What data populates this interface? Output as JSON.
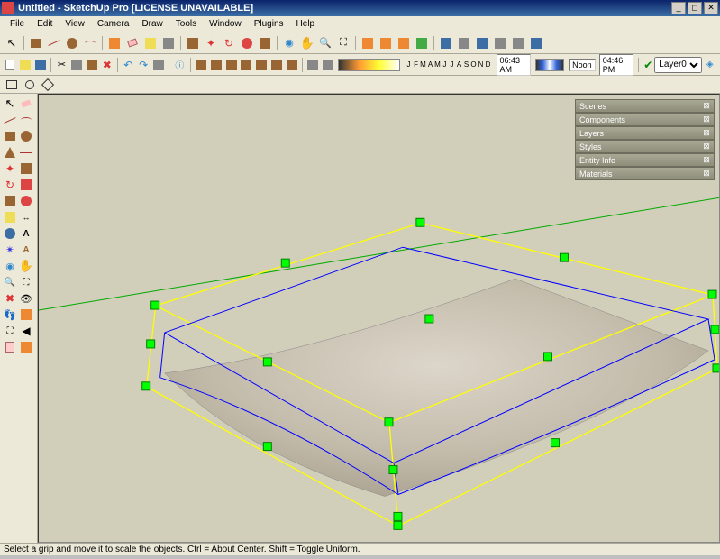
{
  "window": {
    "title": "Untitled - SketchUp Pro [LICENSE UNAVAILABLE]"
  },
  "menus": [
    "File",
    "Edit",
    "View",
    "Camera",
    "Draw",
    "Tools",
    "Window",
    "Plugins",
    "Help"
  ],
  "time_display": {
    "months": [
      "J",
      "F",
      "M",
      "A",
      "M",
      "J",
      "J",
      "A",
      "S",
      "O",
      "N",
      "D"
    ],
    "morning": "06:43 AM",
    "noon": "Noon",
    "afternoon": "04:46 PM"
  },
  "layer": {
    "current": "Layer0"
  },
  "tray": {
    "panels": [
      "Scenes",
      "Components",
      "Layers",
      "Styles",
      "Entity Info",
      "Materials"
    ]
  },
  "status": {
    "text": "Select a grip and move it to scale the objects. Ctrl = About Center. Shift = Toggle Uniform."
  },
  "colors": {
    "bg_viewport": "#d1ceb9",
    "selection_yellow": "#ffff00",
    "selection_blue": "#0000ff",
    "grip_green": "#00ff00",
    "grip_border": "#008000",
    "axis_green": "#00aa00"
  }
}
